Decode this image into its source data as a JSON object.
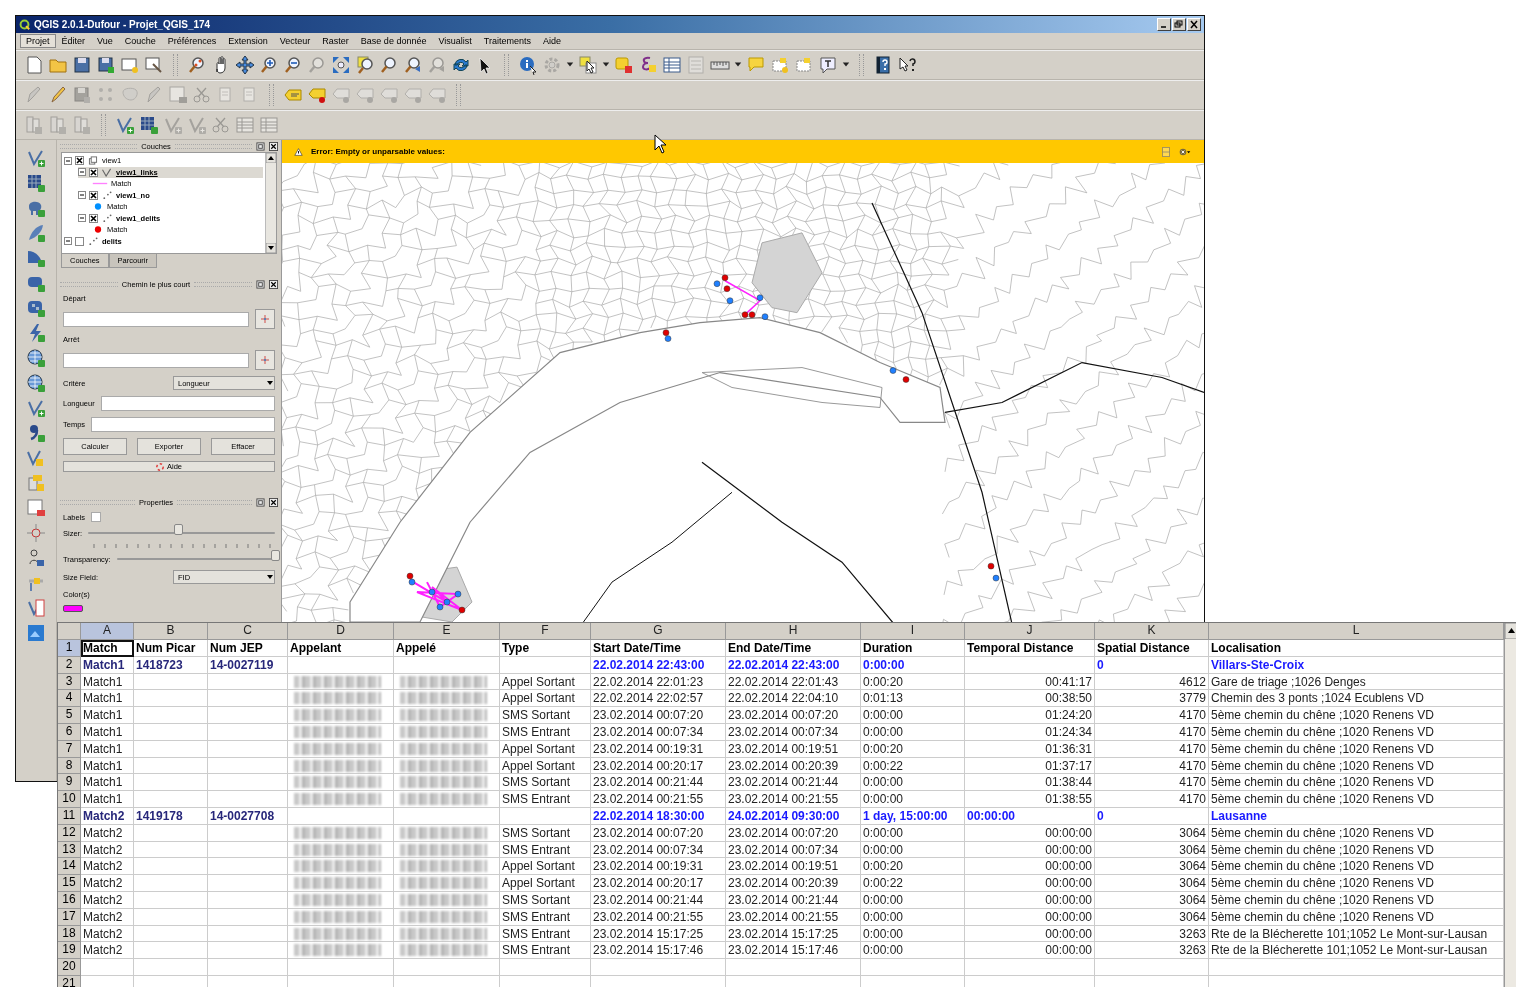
{
  "window": {
    "title": "QGIS 2.0.1-Dufour - Projet_QGIS_174"
  },
  "menu": [
    {
      "label": "Projet",
      "selected": true
    },
    {
      "label": "Éditer",
      "selected": false
    },
    {
      "label": "Vue",
      "selected": false
    },
    {
      "label": "Couche",
      "selected": false
    },
    {
      "label": "Préférences",
      "selected": false
    },
    {
      "label": "Extension",
      "selected": false
    },
    {
      "label": "Vecteur",
      "selected": false
    },
    {
      "label": "Raster",
      "selected": false
    },
    {
      "label": "Base de donnée",
      "selected": false
    },
    {
      "label": "Visualist",
      "selected": false
    },
    {
      "label": "Traitements",
      "selected": false
    },
    {
      "label": "Aide",
      "selected": false
    }
  ],
  "layers_panel": {
    "title": "Couches",
    "tree": [
      {
        "name": "view1",
        "kind": "group",
        "checked": true,
        "expanded": true,
        "selected": false,
        "children": [
          {
            "name": "view1_links",
            "kind": "line-layer",
            "checked": true,
            "expanded": true,
            "selected": true,
            "children": [
              {
                "name": "Match",
                "kind": "legend",
                "symbol": {
                  "kind": "line",
                  "color": "#ff80ff"
                }
              }
            ]
          },
          {
            "name": "view1_no",
            "kind": "point-layer",
            "checked": true,
            "expanded": true,
            "selected": false,
            "children": [
              {
                "name": "Match",
                "kind": "legend",
                "symbol": {
                  "kind": "dot",
                  "color": "#0090ff"
                }
              }
            ]
          },
          {
            "name": "view1_delits",
            "kind": "point-layer",
            "checked": true,
            "expanded": true,
            "selected": false,
            "children": [
              {
                "name": "Match",
                "kind": "legend",
                "symbol": {
                  "kind": "dot",
                  "color": "#ee0000"
                }
              }
            ]
          }
        ]
      },
      {
        "name": "delits",
        "kind": "point-layer",
        "checked": false,
        "expanded": true,
        "selected": false
      }
    ],
    "tabs": [
      {
        "label": "Couches",
        "selected": true
      },
      {
        "label": "Parcourir",
        "selected": false
      }
    ]
  },
  "shortest_path_panel": {
    "title": "Chemin le plus court",
    "start": {
      "label": "Départ"
    },
    "stop": {
      "label": "Arrêt"
    },
    "criterion": {
      "label": "Critère",
      "value": "Longueur"
    },
    "length": {
      "label": "Longueur"
    },
    "time": {
      "label": "Temps"
    },
    "buttons": [
      "Calculer",
      "Exporter",
      "Effacer"
    ],
    "help_button": "Aide"
  },
  "properties_panel": {
    "title": "Properties",
    "labels": {
      "label": "Labels",
      "checked": false
    },
    "sizer": {
      "label": "Sizer:",
      "level": 0.48
    },
    "transparency": {
      "label": "Transparency:",
      "level": 1.0
    },
    "size_field": {
      "label": "Size Field:",
      "value": "FID"
    },
    "colors": {
      "label": "Color(s)",
      "color": "#ff00ff"
    }
  },
  "message_bar": {
    "text": "Error: Empty or unparsable values:"
  },
  "spreadsheet": {
    "columns": [
      {
        "letter": "A",
        "selected": true
      },
      {
        "letter": "B",
        "selected": false
      },
      {
        "letter": "C",
        "selected": false
      },
      {
        "letter": "D",
        "selected": false
      },
      {
        "letter": "E",
        "selected": false
      },
      {
        "letter": "F",
        "selected": false
      },
      {
        "letter": "G",
        "selected": false
      },
      {
        "letter": "H",
        "selected": false
      },
      {
        "letter": "I",
        "selected": false
      },
      {
        "letter": "J",
        "selected": false
      },
      {
        "letter": "K",
        "selected": false
      },
      {
        "letter": "L",
        "selected": false
      }
    ],
    "rows": [
      {
        "number": "1",
        "kind": "header",
        "selected": true,
        "match": "Match",
        "num_picar": "Num Picar",
        "num_jep": "Num JEP",
        "appelant": "Appelant",
        "appele": "Appelé",
        "type": "Type",
        "start": "Start Date/Time",
        "end": "End Date/Time",
        "duration": "Duration",
        "temporal_distance": "Temporal Distance",
        "spatial_distance": "Spatial Distance",
        "localisation": "Localisation"
      },
      {
        "number": "2",
        "kind": "summary",
        "selected": false,
        "match": "Match1",
        "num_picar": "1418723",
        "num_jep": "14-0027119",
        "start": "22.02.2014 22:43:00",
        "end": "22.02.2014 22:43:00",
        "duration": "0:00:00",
        "spatial_distance": "0",
        "localisation": "Villars-Ste-Croix"
      },
      {
        "number": "3",
        "kind": "detail",
        "selected": false,
        "match": "Match1",
        "type": "Appel Sortant",
        "start": "22.02.2014 22:01:23",
        "end": "22.02.2014 22:01:43",
        "duration": "0:00:20",
        "temporal_distance": "00:41:17",
        "spatial_distance": "4612",
        "localisation": "Gare de triage ;1026 Denges"
      },
      {
        "number": "4",
        "kind": "detail",
        "selected": false,
        "match": "Match1",
        "type": "Appel Sortant",
        "start": "22.02.2014 22:02:57",
        "end": "22.02.2014 22:04:10",
        "duration": "0:01:13",
        "temporal_distance": "00:38:50",
        "spatial_distance": "3779",
        "localisation": "Chemin des 3 ponts ;1024 Ecublens VD"
      },
      {
        "number": "5",
        "kind": "detail",
        "selected": false,
        "match": "Match1",
        "type": "SMS Sortant",
        "start": "23.02.2014 00:07:20",
        "end": "23.02.2014 00:07:20",
        "duration": "0:00:00",
        "temporal_distance": "01:24:20",
        "spatial_distance": "4170",
        "localisation": "5ème chemin du chêne ;1020 Renens VD"
      },
      {
        "number": "6",
        "kind": "detail",
        "selected": false,
        "match": "Match1",
        "type": "SMS Entrant",
        "start": "23.02.2014 00:07:34",
        "end": "23.02.2014 00:07:34",
        "duration": "0:00:00",
        "temporal_distance": "01:24:34",
        "spatial_distance": "4170",
        "localisation": "5ème chemin du chêne ;1020 Renens VD"
      },
      {
        "number": "7",
        "kind": "detail",
        "selected": false,
        "match": "Match1",
        "type": "Appel Sortant",
        "start": "23.02.2014 00:19:31",
        "end": "23.02.2014 00:19:51",
        "duration": "0:00:20",
        "temporal_distance": "01:36:31",
        "spatial_distance": "4170",
        "localisation": "5ème chemin du chêne ;1020 Renens VD"
      },
      {
        "number": "8",
        "kind": "detail",
        "selected": false,
        "match": "Match1",
        "type": "Appel Sortant",
        "start": "23.02.2014 00:20:17",
        "end": "23.02.2014 00:20:39",
        "duration": "0:00:22",
        "temporal_distance": "01:37:17",
        "spatial_distance": "4170",
        "localisation": "5ème chemin du chêne ;1020 Renens VD"
      },
      {
        "number": "9",
        "kind": "detail",
        "selected": false,
        "match": "Match1",
        "type": "SMS Sortant",
        "start": "23.02.2014 00:21:44",
        "end": "23.02.2014 00:21:44",
        "duration": "0:00:00",
        "temporal_distance": "01:38:44",
        "spatial_distance": "4170",
        "localisation": "5ème chemin du chêne ;1020 Renens VD"
      },
      {
        "number": "10",
        "kind": "detail",
        "selected": false,
        "match": "Match1",
        "type": "SMS Entrant",
        "start": "23.02.2014 00:21:55",
        "end": "23.02.2014 00:21:55",
        "duration": "0:00:00",
        "temporal_distance": "01:38:55",
        "spatial_distance": "4170",
        "localisation": "5ème chemin du chêne ;1020 Renens VD"
      },
      {
        "number": "11",
        "kind": "summary",
        "selected": false,
        "match": "Match2",
        "num_picar": "1419178",
        "num_jep": "14-0027708",
        "start": "22.02.2014 18:30:00",
        "end": "24.02.2014 09:30:00",
        "duration": "1 day, 15:00:00",
        "temporal_distance": "00:00:00",
        "spatial_distance": "0",
        "localisation": "Lausanne"
      },
      {
        "number": "12",
        "kind": "detail",
        "selected": false,
        "match": "Match2",
        "type": "SMS Sortant",
        "start": "23.02.2014 00:07:20",
        "end": "23.02.2014 00:07:20",
        "duration": "0:00:00",
        "temporal_distance": "00:00:00",
        "spatial_distance": "3064",
        "localisation": "5ème chemin du chêne ;1020 Renens VD"
      },
      {
        "number": "13",
        "kind": "detail",
        "selected": false,
        "match": "Match2",
        "type": "SMS Entrant",
        "start": "23.02.2014 00:07:34",
        "end": "23.02.2014 00:07:34",
        "duration": "0:00:00",
        "temporal_distance": "00:00:00",
        "spatial_distance": "3064",
        "localisation": "5ème chemin du chêne ;1020 Renens VD"
      },
      {
        "number": "14",
        "kind": "detail",
        "selected": false,
        "match": "Match2",
        "type": "Appel Sortant",
        "start": "23.02.2014 00:19:31",
        "end": "23.02.2014 00:19:51",
        "duration": "0:00:20",
        "temporal_distance": "00:00:00",
        "spatial_distance": "3064",
        "localisation": "5ème chemin du chêne ;1020 Renens VD"
      },
      {
        "number": "15",
        "kind": "detail",
        "selected": false,
        "match": "Match2",
        "type": "Appel Sortant",
        "start": "23.02.2014 00:20:17",
        "end": "23.02.2014 00:20:39",
        "duration": "0:00:22",
        "temporal_distance": "00:00:00",
        "spatial_distance": "3064",
        "localisation": "5ème chemin du chêne ;1020 Renens VD"
      },
      {
        "number": "16",
        "kind": "detail",
        "selected": false,
        "match": "Match2",
        "type": "SMS Sortant",
        "start": "23.02.2014 00:21:44",
        "end": "23.02.2014 00:21:44",
        "duration": "0:00:00",
        "temporal_distance": "00:00:00",
        "spatial_distance": "3064",
        "localisation": "5ème chemin du chêne ;1020 Renens VD"
      },
      {
        "number": "17",
        "kind": "detail",
        "selected": false,
        "match": "Match2",
        "type": "SMS Entrant",
        "start": "23.02.2014 00:21:55",
        "end": "23.02.2014 00:21:55",
        "duration": "0:00:00",
        "temporal_distance": "00:00:00",
        "spatial_distance": "3064",
        "localisation": "5ème chemin du chêne ;1020 Renens VD"
      },
      {
        "number": "18",
        "kind": "detail",
        "selected": false,
        "match": "Match2",
        "type": "SMS Entrant",
        "start": "23.02.2014 15:17:25",
        "end": "23.02.2014 15:17:25",
        "duration": "0:00:00",
        "temporal_distance": "00:00:00",
        "spatial_distance": "3263",
        "localisation": "Rte de la Blécherette 101;1052 Le Mont-sur-Lausan"
      },
      {
        "number": "19",
        "kind": "detail",
        "selected": false,
        "match": "Match2",
        "type": "SMS Entrant",
        "start": "23.02.2014 15:17:46",
        "end": "23.02.2014 15:17:46",
        "duration": "0:00:00",
        "temporal_distance": "00:00:00",
        "spatial_distance": "3263",
        "localisation": "Rte de la Blécherette 101;1052 Le Mont-sur-Lausan"
      },
      {
        "number": "20",
        "kind": "empty",
        "selected": false
      },
      {
        "number": "21",
        "kind": "empty",
        "selected": false
      }
    ]
  }
}
